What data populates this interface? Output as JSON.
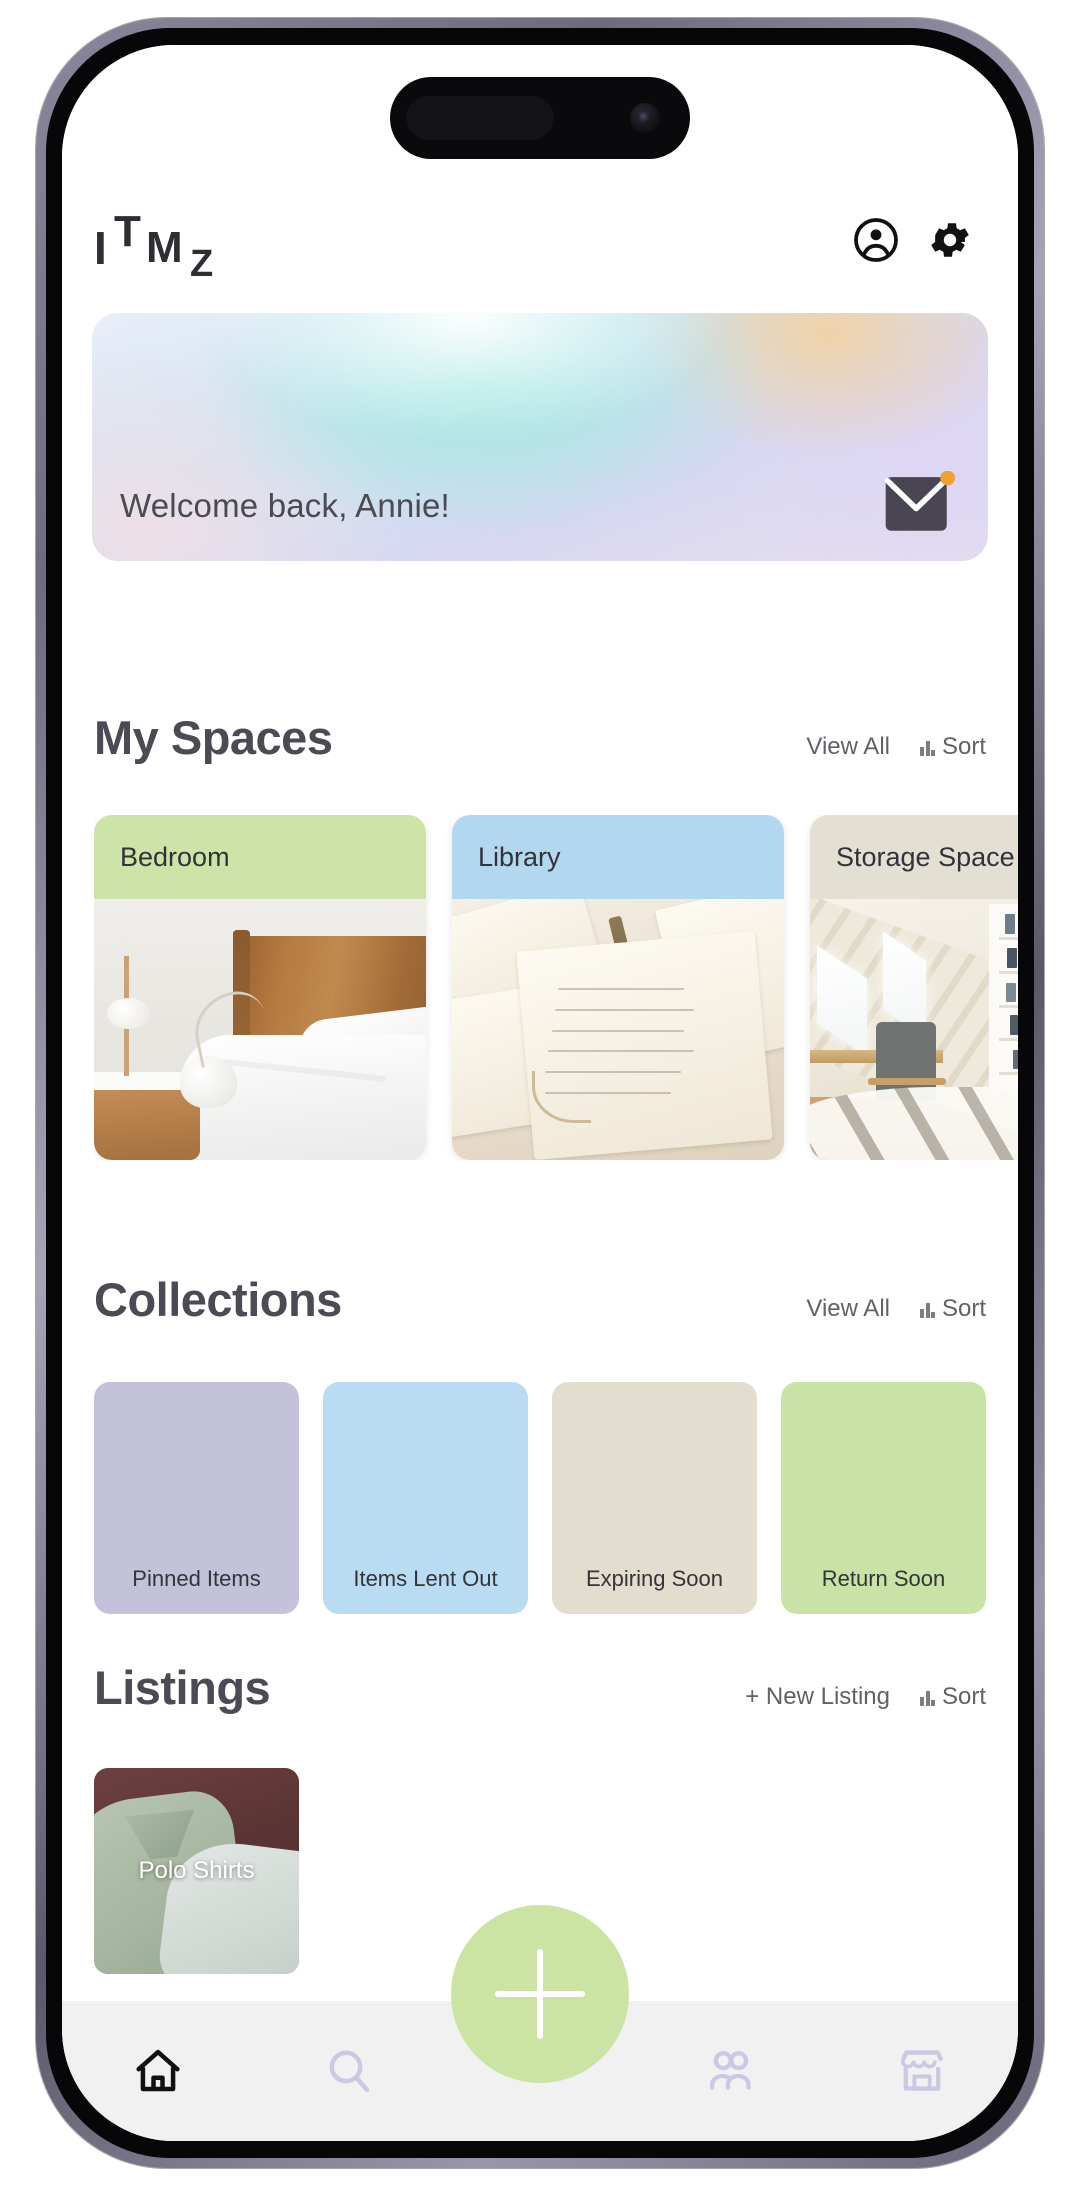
{
  "app": {
    "logo": {
      "l1": "I",
      "l2": "T",
      "l3": "M",
      "l4": "Z"
    },
    "header_icons": [
      {
        "name": "account-circle-icon",
        "label": "Account"
      },
      {
        "name": "gear-icon",
        "label": "Settings"
      }
    ]
  },
  "banner": {
    "greeting": "Welcome back, Annie!",
    "mail_icon": "envelope-icon",
    "has_notification": true,
    "notification_color": "#f0a030"
  },
  "spaces": {
    "title": "My Spaces",
    "view_all": "View All",
    "sort": "Sort",
    "items": [
      {
        "label": "Bedroom",
        "header_color": "#cde3a7",
        "photo": "bedroom"
      },
      {
        "label": "Library",
        "header_color": "#b3d7ee",
        "photo": "library"
      },
      {
        "label": "Storage Space",
        "header_color": "#e3dfd2",
        "photo": "storage"
      }
    ]
  },
  "collections": {
    "title": "Collections",
    "view_all": "View All",
    "sort": "Sort",
    "items": [
      {
        "label": "Pinned Items",
        "color": "#c3c2da"
      },
      {
        "label": "Items Lent Out",
        "color": "#b9dcf2"
      },
      {
        "label": "Expiring Soon",
        "color": "#e2ddce"
      },
      {
        "label": "Return Soon",
        "color": "#c8e3a5"
      }
    ]
  },
  "listings": {
    "title": "Listings",
    "new_listing": "+ New Listing",
    "sort": "Sort",
    "items": [
      {
        "label": "Polo Shirts"
      }
    ]
  },
  "bottom_nav": {
    "items": [
      {
        "name": "home-icon",
        "label": "Home",
        "active": true
      },
      {
        "name": "search-icon",
        "label": "Search",
        "active": false
      },
      {
        "name": "people-icon",
        "label": "Community",
        "active": false
      },
      {
        "name": "storefront-icon",
        "label": "Marketplace",
        "active": false
      }
    ],
    "fab": {
      "name": "add-icon",
      "label": "Add",
      "color": "#cbe3a3"
    }
  },
  "colors": {
    "accent_green": "#cbe3a3",
    "text_dark": "#4e4a55",
    "nav_inactive": "#c9cae2",
    "nav_bg": "#f1f1f1"
  }
}
